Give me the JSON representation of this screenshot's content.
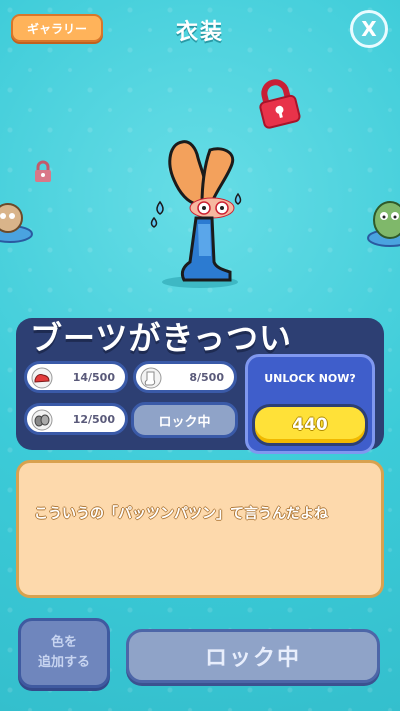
{
  "header": {
    "gallery_label": "ギャラリー",
    "title": "衣装",
    "close_label": "X"
  },
  "costume": {
    "name": "ブーツがきっつい",
    "materials": [
      {
        "icon": "red-shoe-icon",
        "count": "14/500"
      },
      {
        "icon": "white-sock-icon",
        "count": "8/500"
      },
      {
        "icon": "grey-item-icon",
        "count": "12/500"
      }
    ],
    "locked_label": "ロック中"
  },
  "unlock": {
    "label": "UNLOCK NOW?",
    "price": "440"
  },
  "dialog": {
    "text": "こういうの「パッツンパツン」て言うんだよね"
  },
  "footer": {
    "add_color_line1": "色を",
    "add_color_line2": "追加する",
    "locked_button_label": "ロック中"
  },
  "colors": {
    "background": "#3ccbd8",
    "panel": "#2d3f73",
    "unlock_panel": "#3f5ecb",
    "unlock_button": "#ffe138",
    "gallery_button": "#ffb35a",
    "dialog_bg": "#fdd9ac",
    "lock_icon": "#e8334a"
  }
}
